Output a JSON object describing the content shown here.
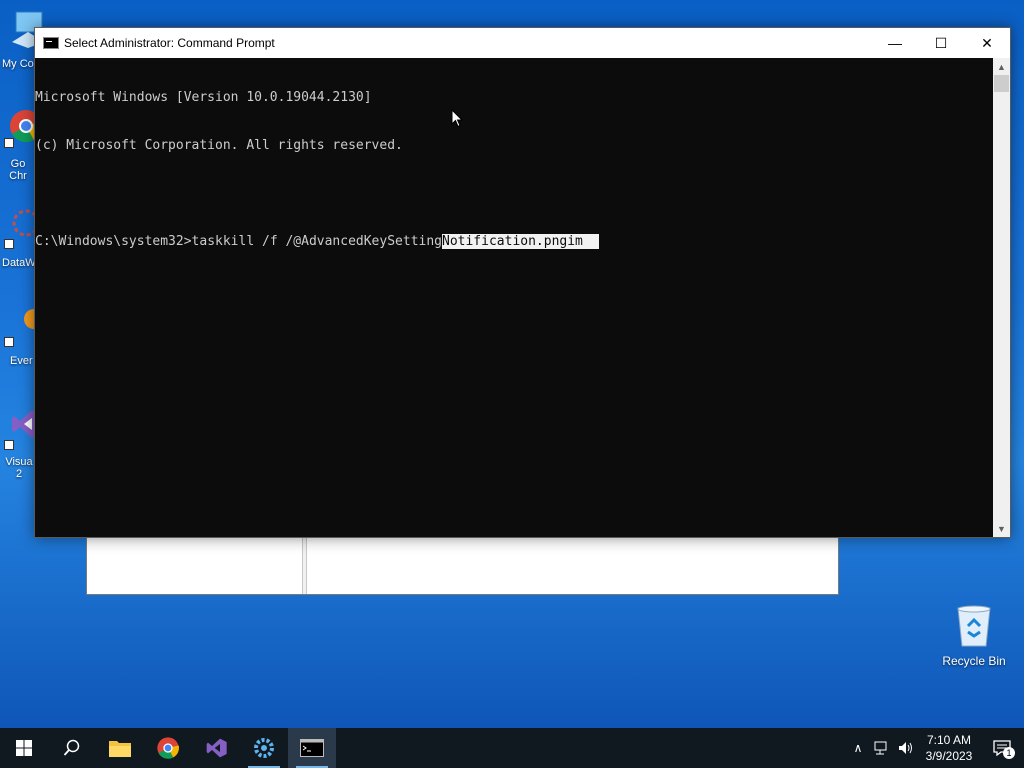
{
  "desktop": {
    "icons": [
      {
        "label": "My Co"
      },
      {
        "label": "Go Chr"
      },
      {
        "label": "DataW"
      },
      {
        "label": "Ever"
      },
      {
        "label": "Visua 2"
      }
    ],
    "recycle_bin": {
      "label": "Recycle Bin"
    }
  },
  "cmd": {
    "title": "Select Administrator:  Command Prompt",
    "lines": [
      "Microsoft Windows [Version 10.0.19044.2130]",
      "(c) Microsoft Corporation. All rights reserved.",
      ""
    ],
    "prompt": "C:\\Windows\\system32>",
    "command_plain": "taskkill /f /@AdvancedKeySetting",
    "command_selected": "Notification.pngim  ",
    "controls": {
      "minimize": "—",
      "maximize": "☐",
      "close": "✕"
    },
    "scroll_up": "▲",
    "scroll_down": "▼"
  },
  "taskbar": {
    "apps": [
      {
        "name": "start"
      },
      {
        "name": "search"
      },
      {
        "name": "file-explorer"
      },
      {
        "name": "chrome"
      },
      {
        "name": "visual-studio"
      },
      {
        "name": "app"
      },
      {
        "name": "command-prompt"
      }
    ],
    "tray": {
      "chevron": "∧",
      "time": "7:10 AM",
      "date": "3/9/2023",
      "notification_count": "1"
    }
  },
  "colors": {
    "console_bg": "#0c0c0c",
    "console_text": "#cccccc",
    "taskbar_bg": "#101820",
    "accent": "#76b9ed"
  }
}
